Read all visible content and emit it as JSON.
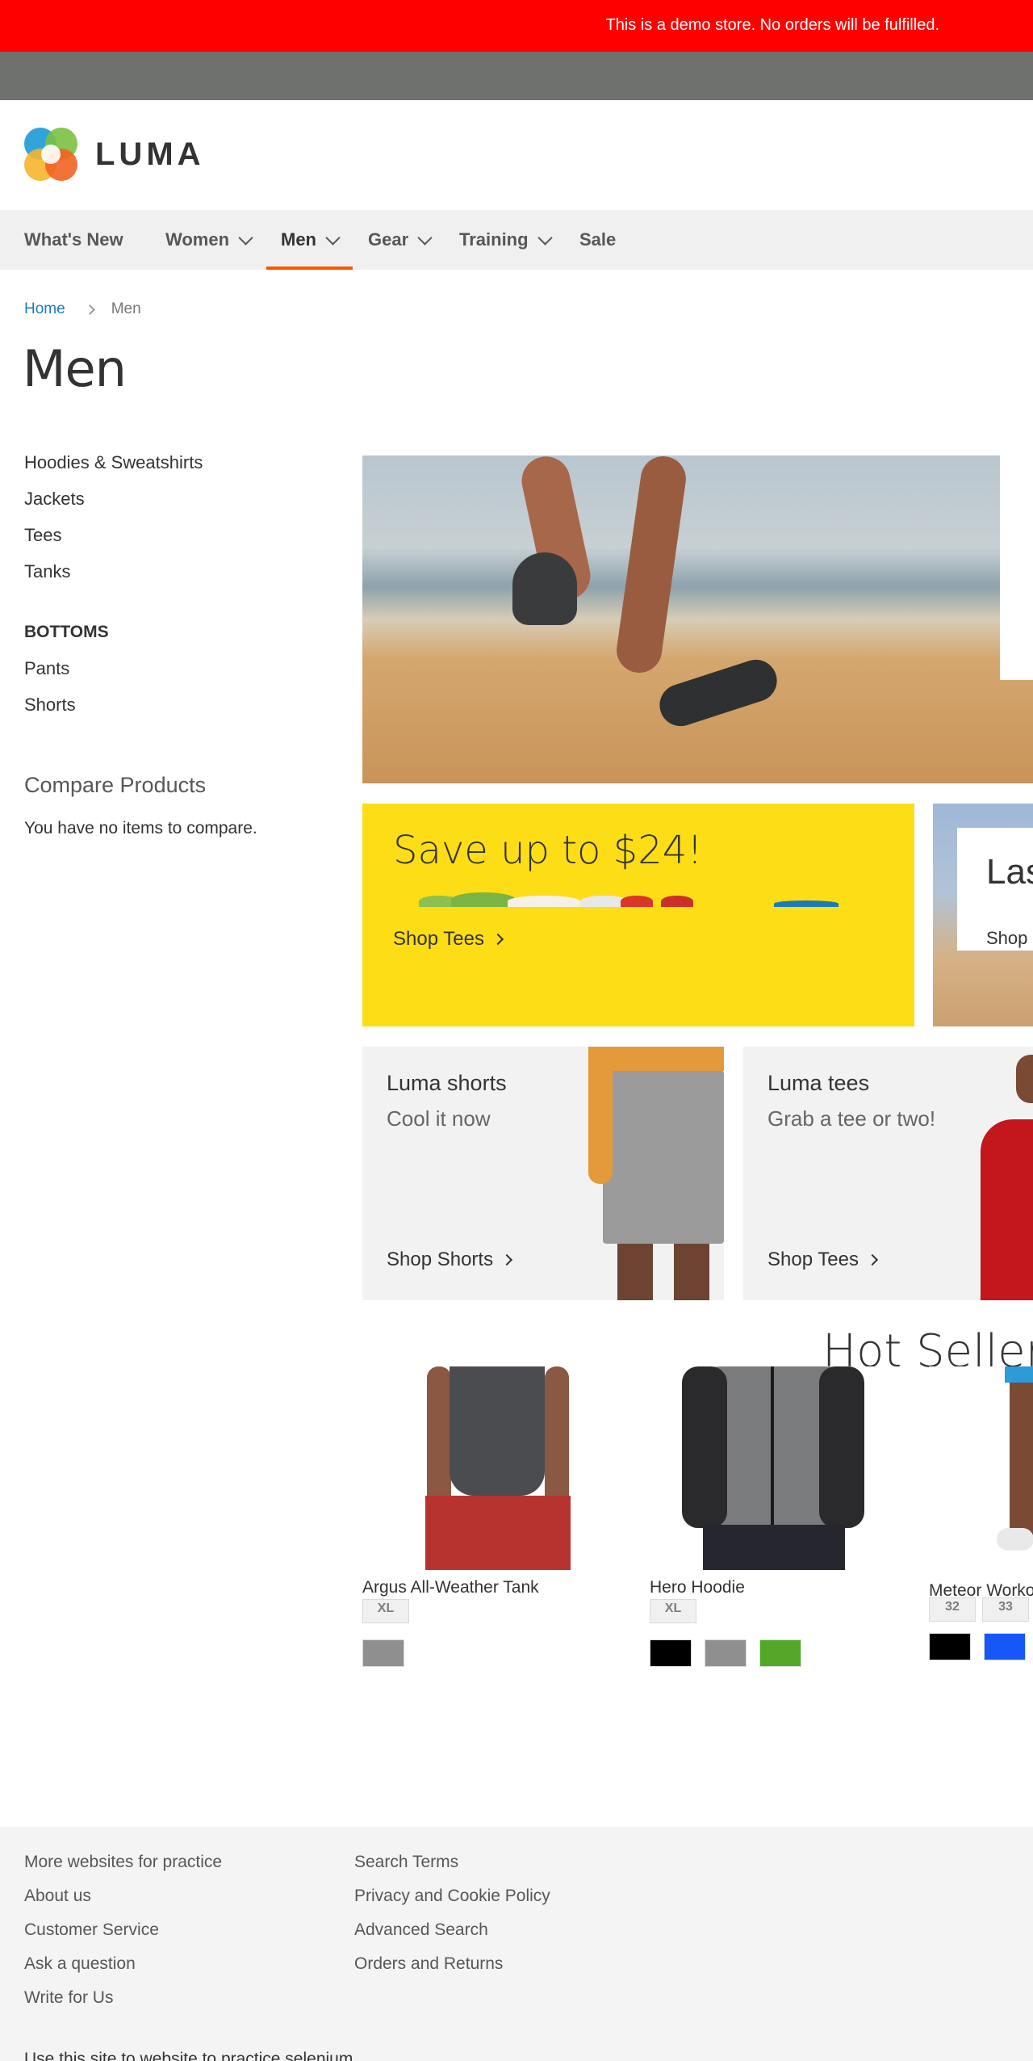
{
  "demo_notice": "This is a demo store. No orders will be fulfilled.",
  "logo": {
    "text": "LUMA"
  },
  "nav": [
    {
      "label": "What's New",
      "has_menu": false
    },
    {
      "label": "Women",
      "has_menu": true
    },
    {
      "label": "Men",
      "has_menu": true,
      "active": true
    },
    {
      "label": "Gear",
      "has_menu": true
    },
    {
      "label": "Training",
      "has_menu": true
    },
    {
      "label": "Sale",
      "has_menu": false
    }
  ],
  "breadcrumb": {
    "home": "Home",
    "current": "Men"
  },
  "page_title": "Men",
  "sidebar": {
    "tops": [
      "Hoodies & Sweatshirts",
      "Jackets",
      "Tees",
      "Tanks"
    ],
    "bottoms_heading": "BOTTOMS",
    "bottoms": [
      "Pants",
      "Shorts"
    ],
    "compare_title": "Compare Products",
    "compare_empty": "You have no items to compare."
  },
  "promos": {
    "yellow": {
      "title": "Save up to $24!",
      "link": "Shop Tees"
    },
    "beach": {
      "title": "Las",
      "link": "Shop"
    },
    "shorts": {
      "title": "Luma shorts",
      "subtitle": "Cool it now",
      "link": "Shop Shorts"
    },
    "tees": {
      "title": "Luma tees",
      "subtitle": "Grab a tee or two!",
      "link": "Shop Tees"
    }
  },
  "hot_sellers_title": "Hot Sellers",
  "products": [
    {
      "name": "Argus All-Weather Tank",
      "sizes": [
        "XL"
      ],
      "colors": [
        "#8f8f8f"
      ]
    },
    {
      "name": "Hero Hoodie",
      "sizes": [
        "XL"
      ],
      "colors": [
        "#000000",
        "#8f8f8f",
        "#53a828"
      ]
    },
    {
      "name": "Meteor Workout Short",
      "sizes": [
        "32",
        "33"
      ],
      "colors": [
        "#000000",
        "#1857f7"
      ]
    }
  ],
  "footer": {
    "col1": [
      "More websites for practice",
      "About us",
      "Customer Service",
      "Ask a question",
      "Write for Us"
    ],
    "col2": [
      "Search Terms",
      "Privacy and Cookie Policy",
      "Advanced Search",
      "Orders and Returns"
    ],
    "bottom_text": "Use this site to website to practice selenium"
  },
  "colors": {
    "demo_bar": "#ff0000",
    "nav_active": "#ff5501",
    "link": "#1979c3",
    "promo_yellow": "#fddd16"
  }
}
